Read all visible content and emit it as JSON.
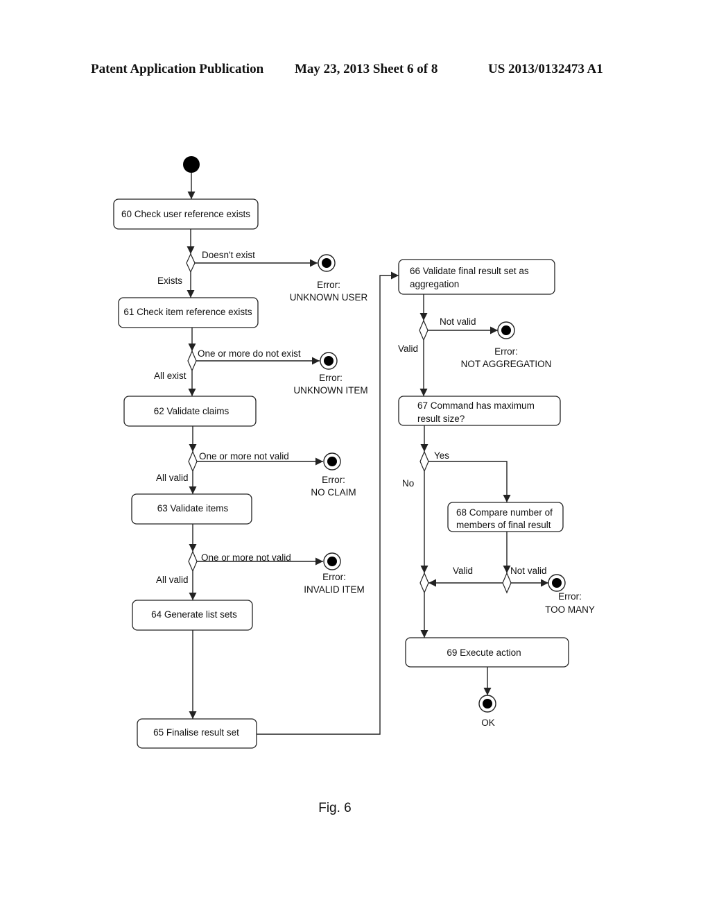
{
  "header": {
    "publication": "Patent Application Publication",
    "date_sheet": "May 23, 2013  Sheet 6 of 8",
    "number": "US 2013/0132473 A1"
  },
  "figure": {
    "caption": "Fig. 6",
    "activities": [
      {
        "id": "60",
        "lines": [
          "60 Check user reference exists"
        ]
      },
      {
        "id": "61",
        "lines": [
          "61 Check item reference exists"
        ]
      },
      {
        "id": "62",
        "lines": [
          "62 Validate claims"
        ]
      },
      {
        "id": "63",
        "lines": [
          "63 Validate items"
        ]
      },
      {
        "id": "64",
        "lines": [
          "64 Generate list sets"
        ]
      },
      {
        "id": "65",
        "lines": [
          "65 Finalise result set"
        ]
      },
      {
        "id": "66",
        "lines": [
          "66 Validate final result set as",
          "aggregation"
        ]
      },
      {
        "id": "67",
        "lines": [
          "67 Command has maximum",
          "result size?"
        ]
      },
      {
        "id": "68",
        "lines": [
          "68 Compare number of",
          "members of final result"
        ]
      },
      {
        "id": "69",
        "lines": [
          "69 Execute action"
        ]
      }
    ],
    "guards": {
      "d60_fail": "Doesn't exist",
      "d60_ok": "Exists",
      "d61_fail": "One or more do not exist",
      "d61_ok": "All exist",
      "d62_fail": "One or more not valid",
      "d62_ok": "All valid",
      "d63_fail": "One or more not valid",
      "d63_ok": "All valid",
      "d66_fail": "Not valid",
      "d66_ok": "Valid",
      "d67_yes": "Yes",
      "d67_no": "No",
      "d68_ok": "Valid",
      "d68_fail": "Not valid"
    },
    "end_states": {
      "unknown_user": [
        "Error:",
        "UNKNOWN USER"
      ],
      "unknown_item": [
        "Error:",
        "UNKNOWN ITEM"
      ],
      "no_claim": [
        "Error:",
        "NO CLAIM"
      ],
      "invalid_item": [
        "Error:",
        "INVALID ITEM"
      ],
      "not_aggregation": [
        "Error:",
        "NOT AGGREGATION"
      ],
      "too_many": [
        "Error:",
        "TOO MANY"
      ],
      "ok": [
        "OK"
      ]
    }
  }
}
